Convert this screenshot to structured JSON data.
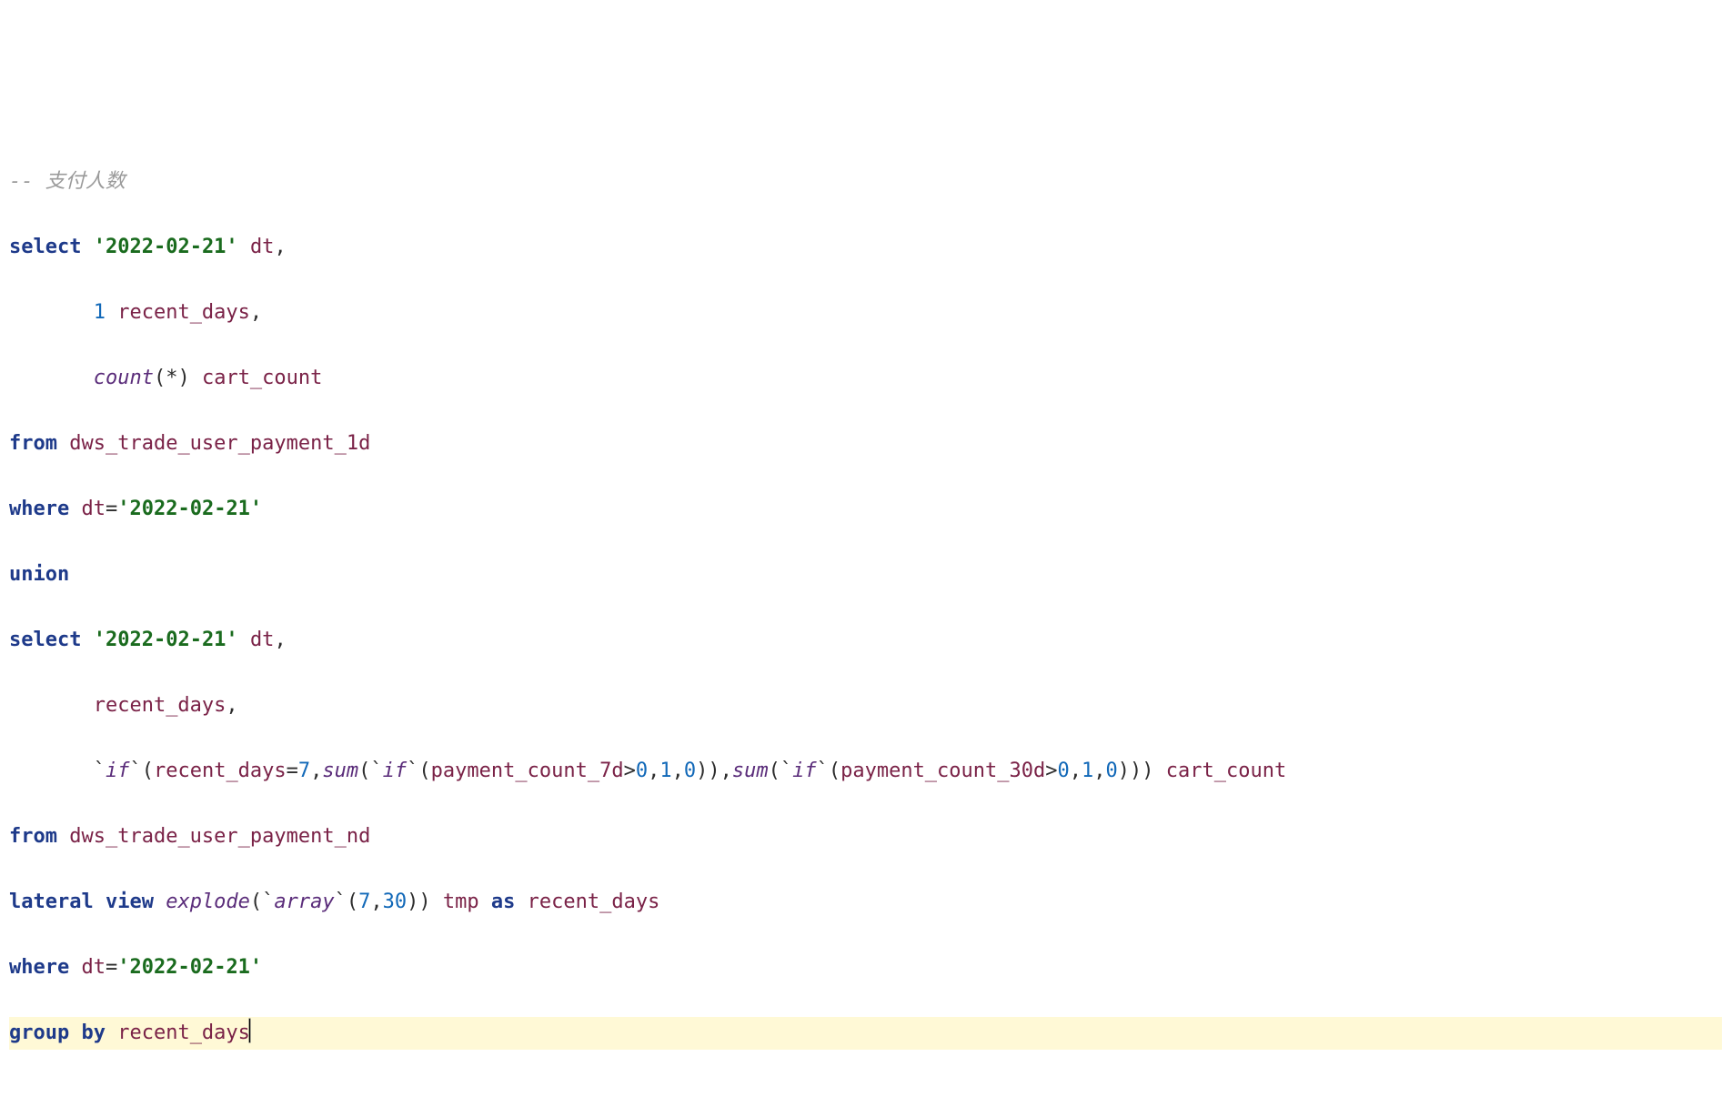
{
  "code": {
    "comment_prefix": "-- ",
    "comment_text": "支付人数",
    "kw": {
      "select": "select",
      "from": "from",
      "where": "where",
      "union": "union",
      "lateral": "lateral",
      "view": "view",
      "as": "as",
      "group_by": "group by"
    },
    "strings": {
      "date": "'2022-02-21'"
    },
    "numbers": {
      "one": "1",
      "seven": "7",
      "thirty": "30",
      "zero": "0"
    },
    "funcs": {
      "count": "count",
      "sum": "sum",
      "explode": "explode",
      "if": "if",
      "array": "array"
    },
    "idents": {
      "dt": "dt",
      "recent_days": "recent_days",
      "cart_count": "cart_count",
      "payment_count_7d": "payment_count_7d",
      "payment_count_30d": "payment_count_30d",
      "dws_trade_user_payment_1d": "dws_trade_user_payment_1d",
      "dws_trade_user_payment_nd": "dws_trade_user_payment_nd",
      "tmp": "tmp"
    },
    "punct": {
      "star": "*",
      "lparen": "(",
      "rparen": ")",
      "comma": ",",
      "eq": "=",
      "gt": ">",
      "backtick": "`"
    },
    "indent": {
      "col_indent": "       "
    }
  }
}
